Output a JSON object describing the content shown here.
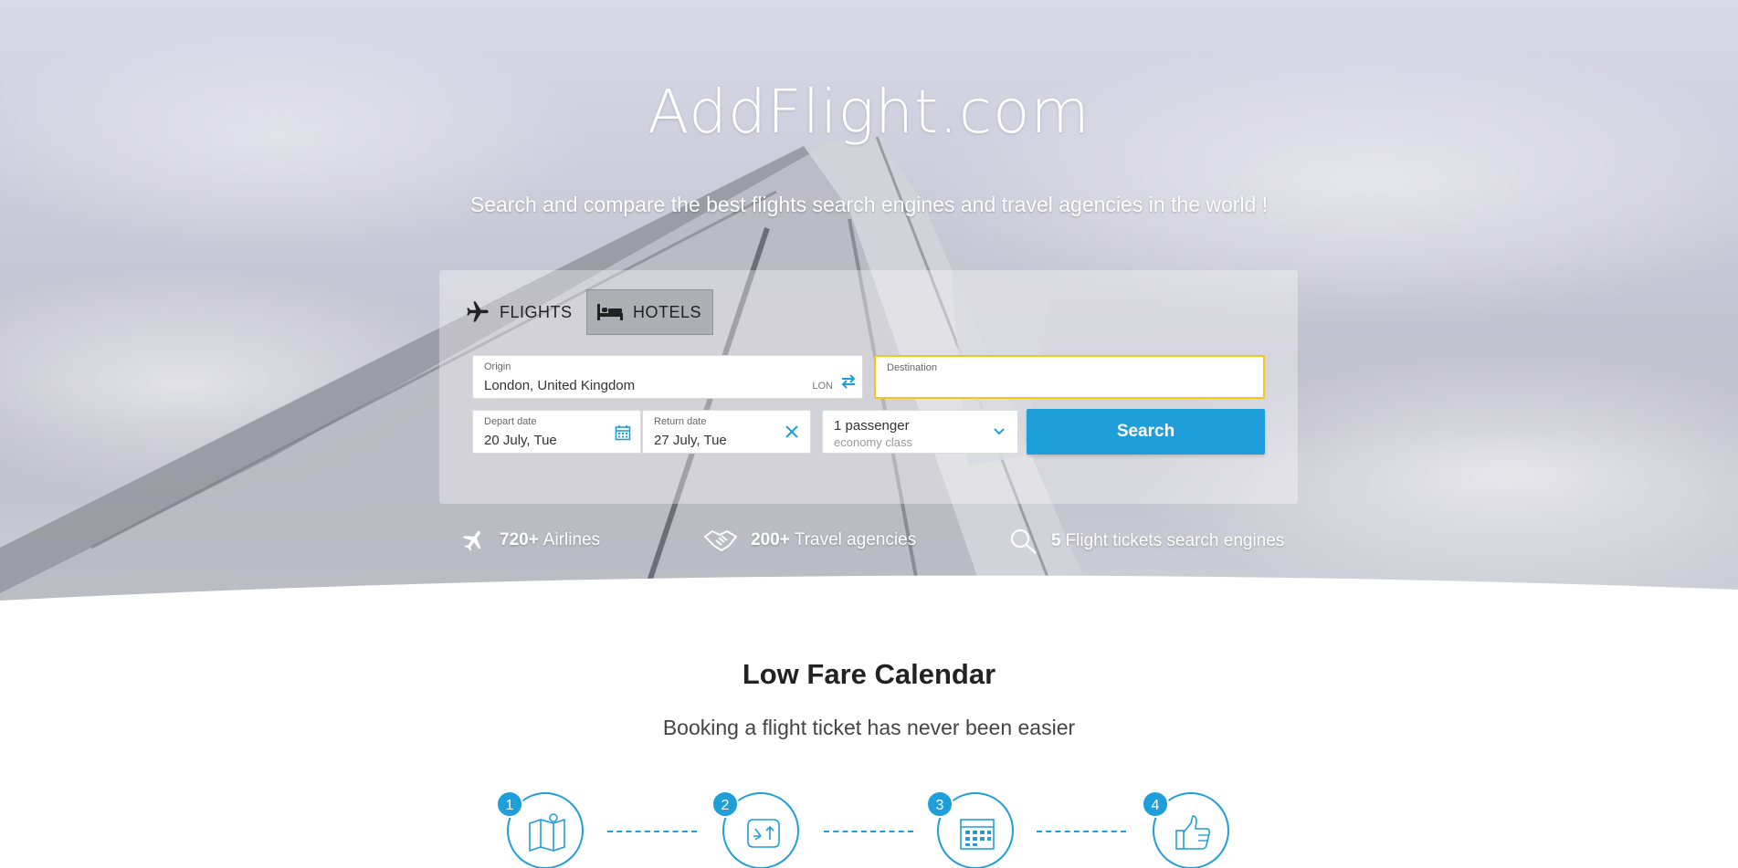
{
  "brand": "AddFlight.com",
  "tagline": "Search and compare the best flights search engines and travel agencies in the world !",
  "tabs": {
    "flights": "FLIGHTS",
    "hotels": "HOTELS"
  },
  "form": {
    "origin_label": "Origin",
    "origin_value": "London, United Kingdom",
    "origin_code": "LON",
    "destination_label": "Destination",
    "destination_value": "",
    "depart_label": "Depart date",
    "depart_value": "20 July, Tue",
    "return_label": "Return date",
    "return_value": "27 July, Tue",
    "passengers": "1 passenger",
    "cabin_class": "economy class",
    "search_label": "Search"
  },
  "stats": [
    {
      "count": "720+",
      "label": "Airlines",
      "icon": "airplane-icon"
    },
    {
      "count": "200+",
      "label": "Travel agencies",
      "icon": "handshake-icon"
    },
    {
      "count": "5",
      "label": "Flight tickets search engines",
      "icon": "search-icon"
    }
  ],
  "section": {
    "title": "Low Fare Calendar",
    "subtitle": "Booking a flight ticket has never been easier"
  },
  "steps": [
    {
      "number": "1",
      "icon": "map-pin-icon"
    },
    {
      "number": "2",
      "icon": "exchange-icon"
    },
    {
      "number": "3",
      "icon": "calendar-icon"
    },
    {
      "number": "4",
      "icon": "thumbs-up-icon"
    }
  ],
  "colors": {
    "accent": "#1f9fd9",
    "focus_border": "#f2c71b",
    "hero_bg": "#c9c8d6"
  }
}
